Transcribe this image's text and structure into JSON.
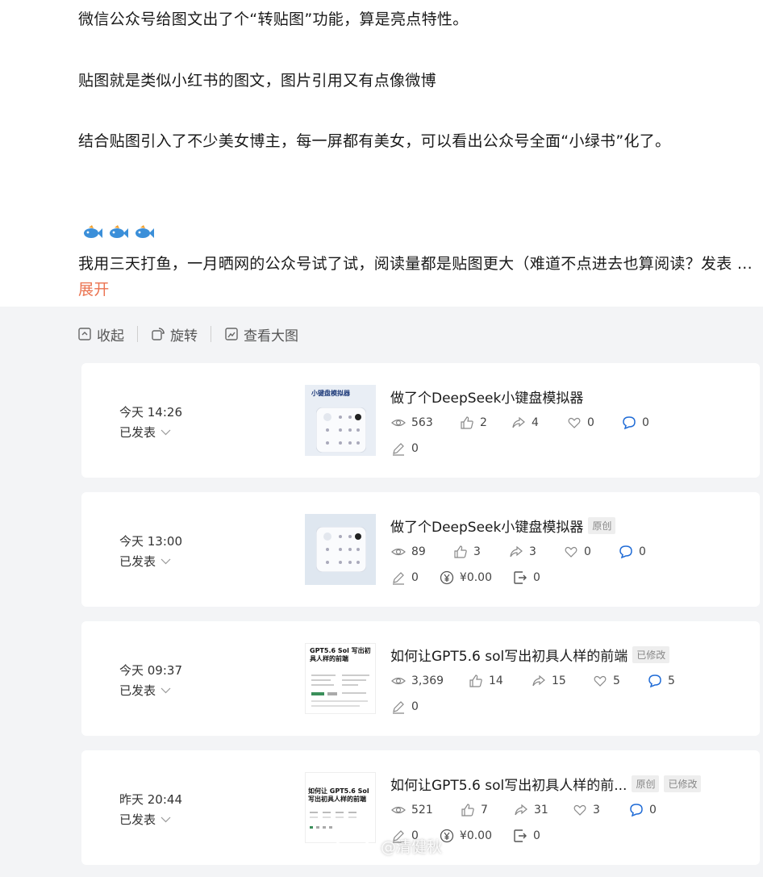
{
  "post": {
    "para1": "微信公众号给图文出了个“转贴图”功能，算是亮点特性。",
    "para2": "贴图就是类似小红书的图文，图片引用又有点像微博",
    "para3": "结合贴图引入了不少美女博主，每一屏都有美女，可以看出公众号全面“小绿书”化了。",
    "emoji_icon": "fish-emoji-icon",
    "para4": "我用三天打鱼，一月晒网的公众号试了试，阅读量都是贴图更大（难道不点进去也算阅读？发表 ... ",
    "expand_label": "展开"
  },
  "toolbar": {
    "collapse_label": "收起",
    "rotate_label": "旋转",
    "view_large_label": "查看大图"
  },
  "articles": [
    {
      "time": "今天 14:26",
      "status": "已发表",
      "thumb_text": "小键盘模拟器",
      "title": "做了个DeepSeek小键盘模拟器",
      "tags": [],
      "views": "563",
      "likes": "2",
      "shares": "4",
      "favs": "0",
      "comments": "0",
      "edits": "0"
    },
    {
      "time": "今天 13:00",
      "status": "已发表",
      "thumb_text": "",
      "title": "做了个DeepSeek小键盘模拟器",
      "tags": [
        "原创"
      ],
      "views": "89",
      "likes": "3",
      "shares": "3",
      "favs": "0",
      "comments": "0",
      "edits": "0",
      "reward": "¥0.00",
      "forward": "0"
    },
    {
      "time": "今天 09:37",
      "status": "已发表",
      "thumb_text": "GPT5.6 Sol 写出初具人样的前端",
      "title": "如何让GPT5.6 sol写出初具人样的前端",
      "tags": [
        "已修改"
      ],
      "views": "3,369",
      "likes": "14",
      "shares": "15",
      "favs": "5",
      "comments": "5",
      "edits": "0"
    },
    {
      "time": "昨天 20:44",
      "status": "已发表",
      "thumb_text": "如何让 GPT5.6 Sol 写出初具人样的前端",
      "title": "如何让GPT5.6 sol写出初具人样的前...",
      "tags": [
        "原创",
        "已修改"
      ],
      "views": "521",
      "likes": "7",
      "shares": "31",
      "favs": "3",
      "comments": "0",
      "edits": "0",
      "reward": "¥0.00",
      "forward": "0"
    }
  ],
  "watermark": {
    "text": "@清健秋"
  },
  "colors": {
    "accent_link": "#eb7350",
    "comment_icon": "#1f6bd6",
    "image_bg": "#f3f4f6"
  }
}
